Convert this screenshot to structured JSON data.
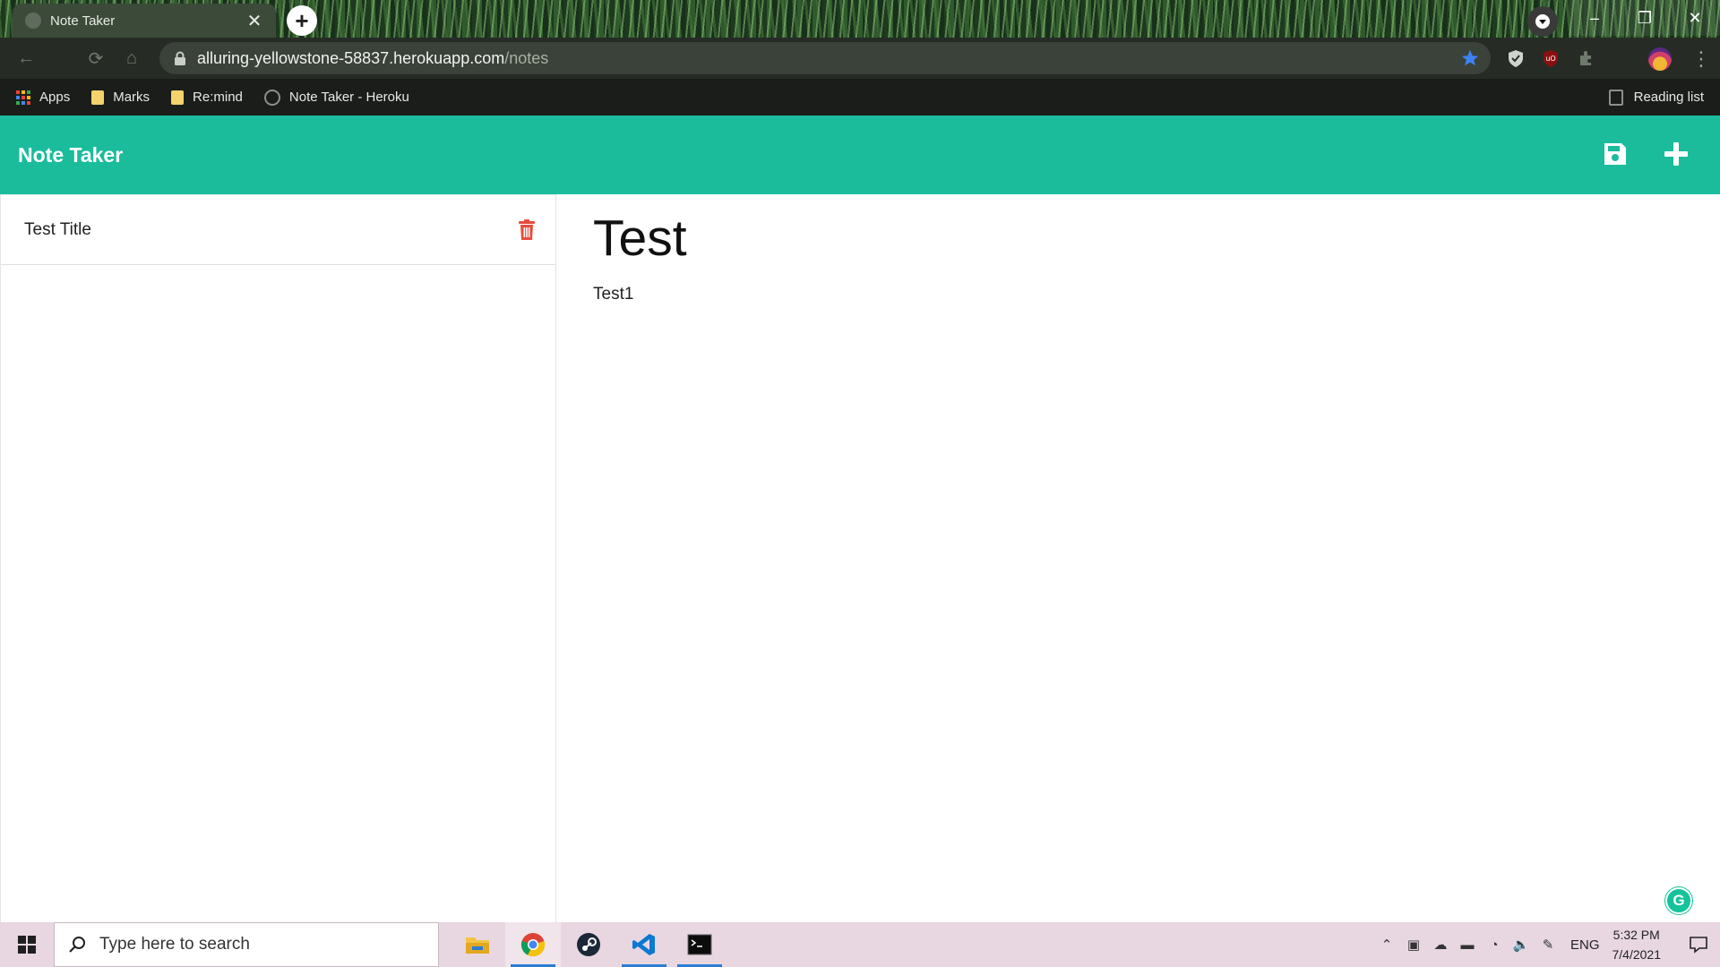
{
  "browser": {
    "tab_title": "Note Taker",
    "tab_close": "✕",
    "new_tab": "+",
    "url_host": "alluring-yellowstone-58837.herokuapp.com",
    "url_path": "/notes",
    "bookmarks": [
      {
        "label": "Apps",
        "icon": "apps-grid-icon"
      },
      {
        "label": "Marks",
        "icon": "folder-icon"
      },
      {
        "label": "Re:mind",
        "icon": "folder-icon"
      },
      {
        "label": "Note Taker - Heroku",
        "icon": "globe-icon"
      }
    ],
    "reading_list": "Reading list",
    "window_controls": [
      "–",
      "❐",
      "✕"
    ],
    "colors": {
      "star": "#3b82f6",
      "ublock": "#8b0f0f"
    }
  },
  "app": {
    "brand": "Note Taker",
    "accent": "#1abc9c",
    "actions": [
      {
        "name": "save-note-icon"
      },
      {
        "name": "new-note-icon"
      }
    ]
  },
  "notes": [
    {
      "title": "Test Title"
    }
  ],
  "active_note": {
    "title": "Test",
    "text": "Test1"
  },
  "grammarly": {
    "label": "G",
    "color": "#15c39a"
  },
  "taskbar": {
    "search_placeholder": "Type here to search",
    "apps": [
      "file-explorer-icon",
      "chrome-icon",
      "steam-icon",
      "vscode-icon",
      "terminal-icon"
    ],
    "language": "ENG",
    "time": "5:32 PM",
    "date": "7/4/2021"
  }
}
